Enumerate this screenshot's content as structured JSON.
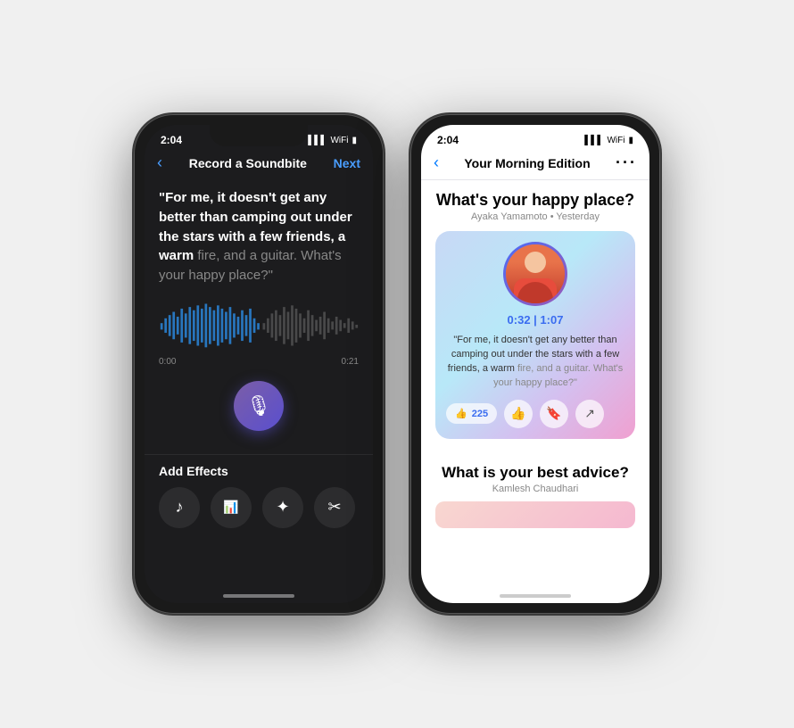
{
  "left_phone": {
    "status_time": "2:04",
    "nav": {
      "back_label": "‹",
      "title": "Record a Soundbite",
      "next_label": "Next"
    },
    "quote": {
      "white_text": "\"For me, it doesn't get any better than camping out under the stars with a few friends, a warm",
      "gray_text": "fire, and a guitar. What's your happy place?\""
    },
    "waveform_time_start": "0:00",
    "waveform_time_end": "0:21",
    "add_effects_label": "Add Effects",
    "effects": [
      {
        "icon": "♪",
        "label": "music"
      },
      {
        "icon": "🎛",
        "label": "eq"
      },
      {
        "icon": "✦",
        "label": "sparkle"
      },
      {
        "icon": "✂",
        "label": "cut"
      }
    ]
  },
  "right_phone": {
    "status_time": "2:04",
    "nav": {
      "back_label": "‹",
      "title": "Your Morning Edition",
      "more_label": "···"
    },
    "post": {
      "title": "What's your happy place?",
      "author": "Ayaka Yamamoto",
      "timestamp": "Yesterday",
      "timer": "0:32 | 1:07",
      "quote_white": "\"For me, it doesn't get any better than camping out under the stars with a few friends, a warm",
      "quote_gray": "fire, and a guitar. What's your happy place?\"",
      "likes": "225"
    },
    "next_post": {
      "title": "What is your best advice?",
      "author": "Kamlesh Chaudhari"
    }
  }
}
